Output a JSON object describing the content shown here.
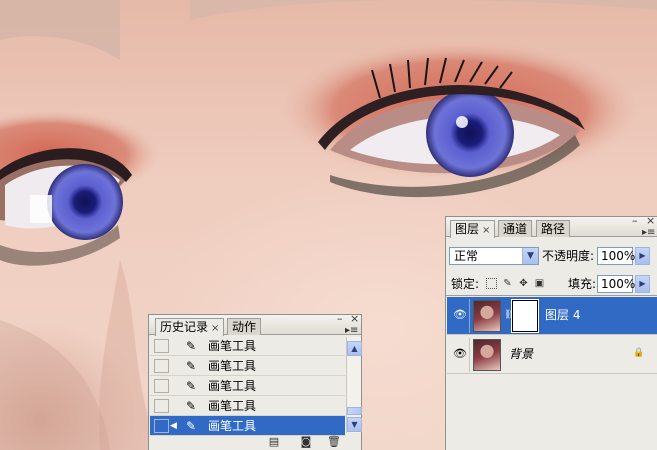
{
  "canvas": {
    "description_icon": "portrait-photo"
  },
  "layers_panel": {
    "tabs": [
      {
        "label": "图层",
        "active": true
      },
      {
        "label": "通道",
        "active": false
      },
      {
        "label": "路径",
        "active": false
      }
    ],
    "tab_close": "×",
    "minimize": "–",
    "close": "×",
    "menu": "▸≡",
    "blend_mode": "正常",
    "opacity_label": "不透明度:",
    "opacity_value": "100%",
    "lock_label": "锁定:",
    "fill_label": "填充:",
    "fill_value": "100%",
    "layers": [
      {
        "name": "图层 4",
        "visible": true,
        "selected": true,
        "has_mask": true
      },
      {
        "name": "背景",
        "visible": true,
        "selected": false,
        "locked": true
      }
    ]
  },
  "history_panel": {
    "tabs": [
      {
        "label": "历史记录",
        "active": true
      },
      {
        "label": "动作",
        "active": false
      }
    ],
    "tab_close": "×",
    "minimize": "–",
    "close": "×",
    "menu": "▸≡",
    "items": [
      {
        "label": "画笔工具",
        "selected": false
      },
      {
        "label": "画笔工具",
        "selected": false
      },
      {
        "label": "画笔工具",
        "selected": false
      },
      {
        "label": "画笔工具",
        "selected": false
      },
      {
        "label": "画笔工具",
        "selected": true
      }
    ]
  },
  "colors": {
    "selection": "#316ac5",
    "panel_bg": "#ecebe6",
    "iris": "#4b4fb8",
    "eyeshadow": "#c8614f"
  }
}
